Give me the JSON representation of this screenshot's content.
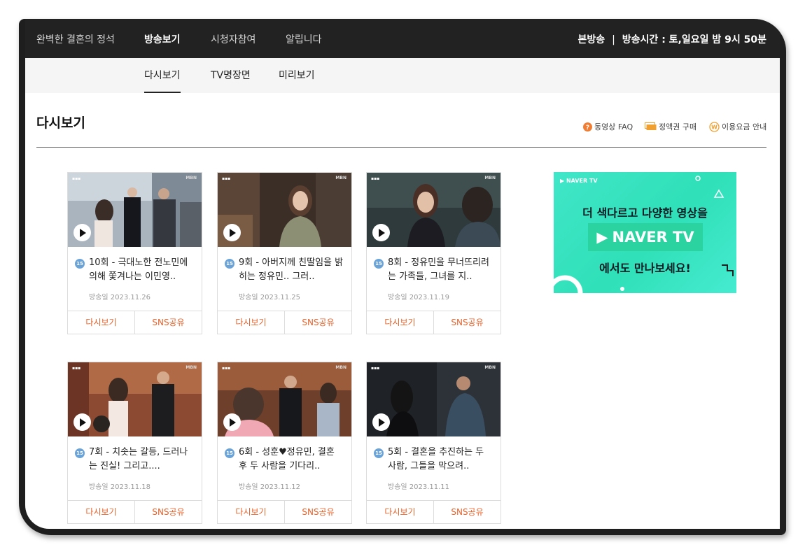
{
  "topbar": {
    "nav": [
      "완벽한 결혼의 정석",
      "방송보기",
      "시청자참여",
      "알립니다"
    ],
    "broadcast_label": "본방송",
    "separator": "|",
    "broadcast_time": "방송시간 : 토,일요일 밤 9시 50분"
  },
  "subnav": {
    "tabs": [
      "다시보기",
      "TV명장면",
      "미리보기"
    ]
  },
  "page": {
    "title": "다시보기",
    "links": [
      {
        "label": "동영상 FAQ",
        "icon": "question-icon",
        "color": "#f07d32"
      },
      {
        "label": "정액권 구매",
        "icon": "ticket-icon",
        "color": "#f0a030"
      },
      {
        "label": "이용요금 안내",
        "icon": "won-coin-icon",
        "color": "#f0a030"
      }
    ]
  },
  "episodes": [
    {
      "age": "15",
      "title": "10회 - 극대노한 전노민에 의해 쫓겨나는 이민영..",
      "date": "방송일 2023.11.26",
      "watch": "다시보기",
      "share": "SNS공유"
    },
    {
      "age": "15",
      "title": "9회 - 아버지께 친딸임을 밝히는 정유민.. 그러..",
      "date": "방송일 2023.11.25",
      "watch": "다시보기",
      "share": "SNS공유"
    },
    {
      "age": "15",
      "title": "8회 - 정유민을 무너뜨리려는 가족들, 그녀를 지..",
      "date": "방송일 2023.11.19",
      "watch": "다시보기",
      "share": "SNS공유"
    },
    {
      "age": "15",
      "title": "7회 - 치솟는 갈등, 드러나는 진실! 그리고....",
      "date": "방송일 2023.11.18",
      "watch": "다시보기",
      "share": "SNS공유"
    },
    {
      "age": "15",
      "title": "6회 - 성훈♥정유민, 결혼 후 두 사람을 기다리..",
      "date": "방송일 2023.11.12",
      "watch": "다시보기",
      "share": "SNS공유"
    },
    {
      "age": "15",
      "title": "5회 - 결혼을 추진하는 두 사람, 그들을 막으려..",
      "date": "방송일 2023.11.11",
      "watch": "다시보기",
      "share": "SNS공유"
    }
  ],
  "thumb_badge": "MBN",
  "ad": {
    "top_label": "NAVER TV",
    "line1": "더 색다르고 다양한 영상을",
    "brand": "NAVER TV",
    "line3": "에서도 만나보세요!"
  },
  "colors": {
    "accent": "#e8622a",
    "topbar": "#222222",
    "ad": "#40e6c8"
  }
}
